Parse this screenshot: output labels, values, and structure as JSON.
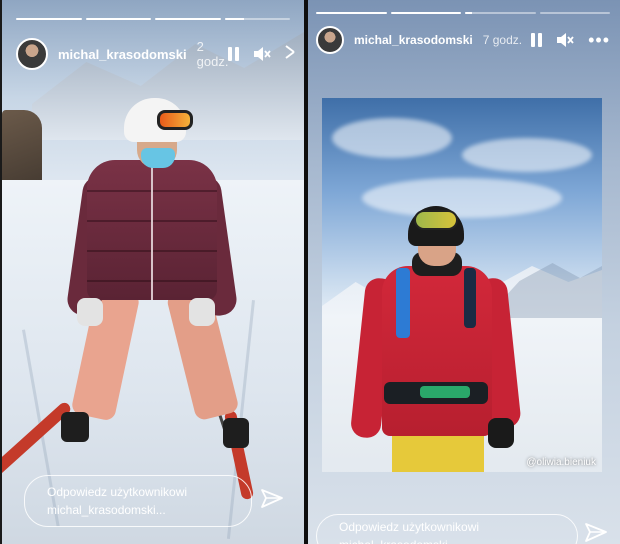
{
  "stories": [
    {
      "username": "michal_krasodomski",
      "time": "2 godz.",
      "progress": [
        1,
        1,
        1,
        0.3
      ],
      "reply_line1": "Odpowiedz użytkownikowi",
      "reply_line2": "michal_krasodomski...",
      "icons": [
        "pause-icon",
        "mute-icon",
        "close-icon",
        "send-icon"
      ]
    },
    {
      "username": "michal_krasodomski",
      "time": "7 godz.",
      "progress": [
        1,
        1,
        0.1,
        0
      ],
      "reply_line1": "Odpowiedz użytkownikowi",
      "reply_line2": "michal_krasodomski...",
      "credit": "@oliwia.bieniuk",
      "icons": [
        "pause-icon",
        "mute-icon",
        "more-icon",
        "send-icon"
      ]
    }
  ]
}
